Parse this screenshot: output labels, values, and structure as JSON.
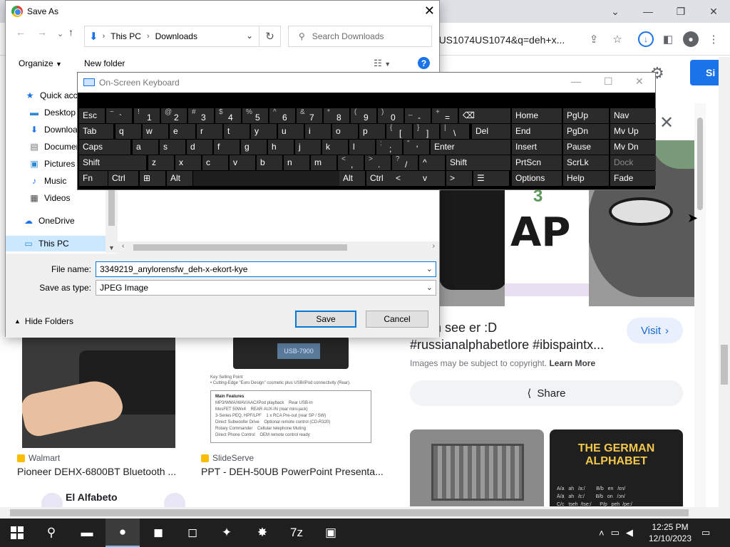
{
  "browser": {
    "omnibox_text": "enUS1074US1074&q=deh+x...",
    "signin_label": "Si",
    "preview": {
      "title": "v deh see er :D #russianalphabetlore #ibispaintx...",
      "visit_label": "Visit",
      "copyright_text": "Images may be subject to copyright.",
      "learn_more": "Learn More",
      "share_label": "Share",
      "image_number": "3",
      "image_glyph": "AP",
      "related2_line1": "THE GERMAN",
      "related2_line2": "ALPHABET",
      "related2_table": "A/a   ah   /a:/        B/b   en   /ɛn/\nÄ/ä   ah   /ɛ:/        B/b   on   /ɔn/\nC/c   tseh  /tse:/      P/p   peh  /pe:/"
    },
    "results": [
      {
        "source": "Walmart",
        "title": "Pioneer DEHX-6800BT Bluetooth ...",
        "source_color": "#fbbc05"
      },
      {
        "source": "SlideServe",
        "title": "PPT - DEH-50UB PowerPoint Presenta...",
        "source_color": "#fbbc05"
      }
    ],
    "result2_screen": "USB-7900",
    "result2_keypoint": "Key Selling Point\n• Cutting-Edge \"Euro Design\" cosmetic plus USB/iPod connectivity (Rear).",
    "result2_features_title": "Main Features",
    "result2_features": "MP3/WMA/WAV/AAC/iPod playback    Rear USB-in\nMosFET 50Wx4    REAR AUX-IN (rear mini-jack)\n3-Series PEQ, HPF/LPF    1 x RCA Pre-out (rear SP / SW)\nDirect Subwoofer Drive    Optional remote control (CD-R320)\nRotary Commander    Cellular telephone Muting\nDirect Phone Control    OEM remote control ready",
    "bottom_text": "El Alfabeto"
  },
  "saveas": {
    "title": "Save As",
    "address": [
      "This PC",
      "Downloads"
    ],
    "search_placeholder": "Search Downloads",
    "organize_label": "Organize",
    "new_folder_label": "New folder",
    "nav_items": [
      {
        "label": "Quick access",
        "icon": "star-icon"
      },
      {
        "label": "Desktop",
        "icon": "desktop-icon"
      },
      {
        "label": "Downloads",
        "icon": "download-icon"
      },
      {
        "label": "Documents",
        "icon": "documents-icon"
      },
      {
        "label": "Pictures",
        "icon": "pictures-icon"
      },
      {
        "label": "Music",
        "icon": "music-icon"
      },
      {
        "label": "Videos",
        "icon": "videos-icon"
      },
      {
        "label": "OneDrive",
        "icon": "cloud-icon"
      },
      {
        "label": "This PC",
        "icon": "computer-icon"
      }
    ],
    "file_name_label": "File name:",
    "file_name_value": "3349219_anylorensfw_deh-x-ekort-kye",
    "save_type_label": "Save as type:",
    "save_type_value": "JPEG Image",
    "hide_folders_label": "Hide Folders",
    "save_label": "Save",
    "cancel_label": "Cancel"
  },
  "osk": {
    "title": "On-Screen Keyboard",
    "rows": [
      [
        {
          "main": "Esc"
        },
        {
          "shift": "~",
          "main": "`"
        },
        {
          "shift": "!",
          "main": "1"
        },
        {
          "shift": "@",
          "main": "2"
        },
        {
          "shift": "#",
          "main": "3"
        },
        {
          "shift": "$",
          "main": "4"
        },
        {
          "shift": "%",
          "main": "5"
        },
        {
          "shift": "^",
          "main": "6"
        },
        {
          "shift": "&",
          "main": "7"
        },
        {
          "shift": "*",
          "main": "8"
        },
        {
          "shift": "(",
          "main": "9"
        },
        {
          "shift": ")",
          "main": "0"
        },
        {
          "shift": "_",
          "main": "-"
        },
        {
          "shift": "+",
          "main": "="
        },
        {
          "main": "⌫"
        },
        {
          "main": "Home"
        },
        {
          "main": "PgUp"
        },
        {
          "main": "Nav"
        }
      ],
      [
        {
          "main": "Tab"
        },
        {
          "main": "q"
        },
        {
          "main": "w"
        },
        {
          "main": "e"
        },
        {
          "main": "r"
        },
        {
          "main": "t"
        },
        {
          "main": "y"
        },
        {
          "main": "u"
        },
        {
          "main": "i"
        },
        {
          "main": "o"
        },
        {
          "main": "p"
        },
        {
          "shift": "{",
          "main": "["
        },
        {
          "shift": "}",
          "main": "]"
        },
        {
          "shift": "|",
          "main": "\\"
        },
        {
          "main": "Del"
        },
        {
          "main": "End"
        },
        {
          "main": "PgDn"
        },
        {
          "main": "Mv Up"
        }
      ],
      [
        {
          "main": "Caps"
        },
        {
          "main": "a"
        },
        {
          "main": "s"
        },
        {
          "main": "d"
        },
        {
          "main": "f"
        },
        {
          "main": "g"
        },
        {
          "main": "h"
        },
        {
          "main": "j"
        },
        {
          "main": "k"
        },
        {
          "main": "l"
        },
        {
          "shift": ":",
          "main": ";"
        },
        {
          "shift": "\"",
          "main": "'"
        },
        {
          "main": "Enter"
        },
        {
          "main": "Insert"
        },
        {
          "main": "Pause"
        },
        {
          "main": "Mv Dn"
        }
      ],
      [
        {
          "main": "Shift"
        },
        {
          "main": "z"
        },
        {
          "main": "x"
        },
        {
          "main": "c"
        },
        {
          "main": "v"
        },
        {
          "main": "b"
        },
        {
          "main": "n"
        },
        {
          "main": "m"
        },
        {
          "shift": "<",
          "main": ","
        },
        {
          "shift": ">",
          "main": "."
        },
        {
          "shift": "?",
          "main": "/"
        },
        {
          "main": "^"
        },
        {
          "main": "Shift"
        },
        {
          "main": "PrtScn"
        },
        {
          "main": "ScrLk"
        },
        {
          "main": "Dock"
        }
      ],
      [
        {
          "main": "Fn"
        },
        {
          "main": "Ctrl"
        },
        {
          "main": "⊞"
        },
        {
          "main": "Alt"
        },
        {
          "main": ""
        },
        {
          "main": "Alt"
        },
        {
          "main": "Ctrl"
        },
        {
          "main": "<"
        },
        {
          "main": "v"
        },
        {
          "main": ">"
        },
        {
          "main": "☰"
        },
        {
          "main": "Options"
        },
        {
          "main": "Help"
        },
        {
          "main": "Fade"
        }
      ]
    ]
  },
  "taskbar": {
    "time": "12:25 PM",
    "date": "12/10/2023",
    "apps": [
      {
        "name": "search-icon",
        "glyph": "⚲"
      },
      {
        "name": "file-explorer-icon",
        "glyph": "▬"
      },
      {
        "name": "chrome-icon",
        "glyph": "●"
      },
      {
        "name": "outlook-icon",
        "glyph": "◼"
      },
      {
        "name": "app-icon",
        "glyph": "◻"
      },
      {
        "name": "app-icon-2",
        "glyph": "✦"
      },
      {
        "name": "app-icon-3",
        "glyph": "✸"
      },
      {
        "name": "7zip-icon",
        "glyph": "7z"
      },
      {
        "name": "app-icon-4",
        "glyph": "▣"
      }
    ]
  },
  "colors": {
    "accent": "#1a73e8",
    "windows_accent": "#0078d7",
    "taskbar": "#1f1f1f",
    "osk_key": "#2b2b2b"
  }
}
